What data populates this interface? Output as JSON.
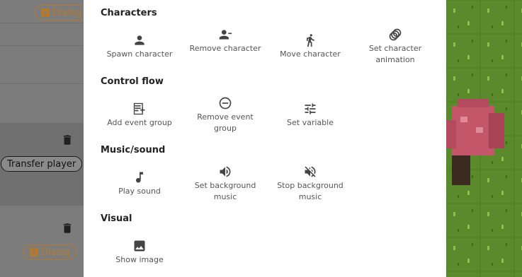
{
  "left_panel": {
    "chips": {
      "dialog_1": "Dialog",
      "transfer": "Transfer player",
      "dialog_2": "Dialog"
    }
  },
  "menu": {
    "sections": {
      "characters": {
        "title": "Characters",
        "items": [
          "Spawn character",
          "Remove character",
          "Move character",
          "Set character animation"
        ]
      },
      "control_flow": {
        "title": "Control flow",
        "items": [
          "Add event group",
          "Remove event group",
          "Set variable"
        ]
      },
      "music_sound": {
        "title": "Music/sound",
        "items": [
          "Play sound",
          "Set background music",
          "Stop background music"
        ]
      },
      "visual": {
        "title": "Visual",
        "items": [
          "Show image"
        ]
      }
    }
  },
  "colors": {
    "chip_dialog": "#b57a2e",
    "icon": "#444444",
    "grass": "#5c8a2e",
    "tree": "#c4566a"
  }
}
